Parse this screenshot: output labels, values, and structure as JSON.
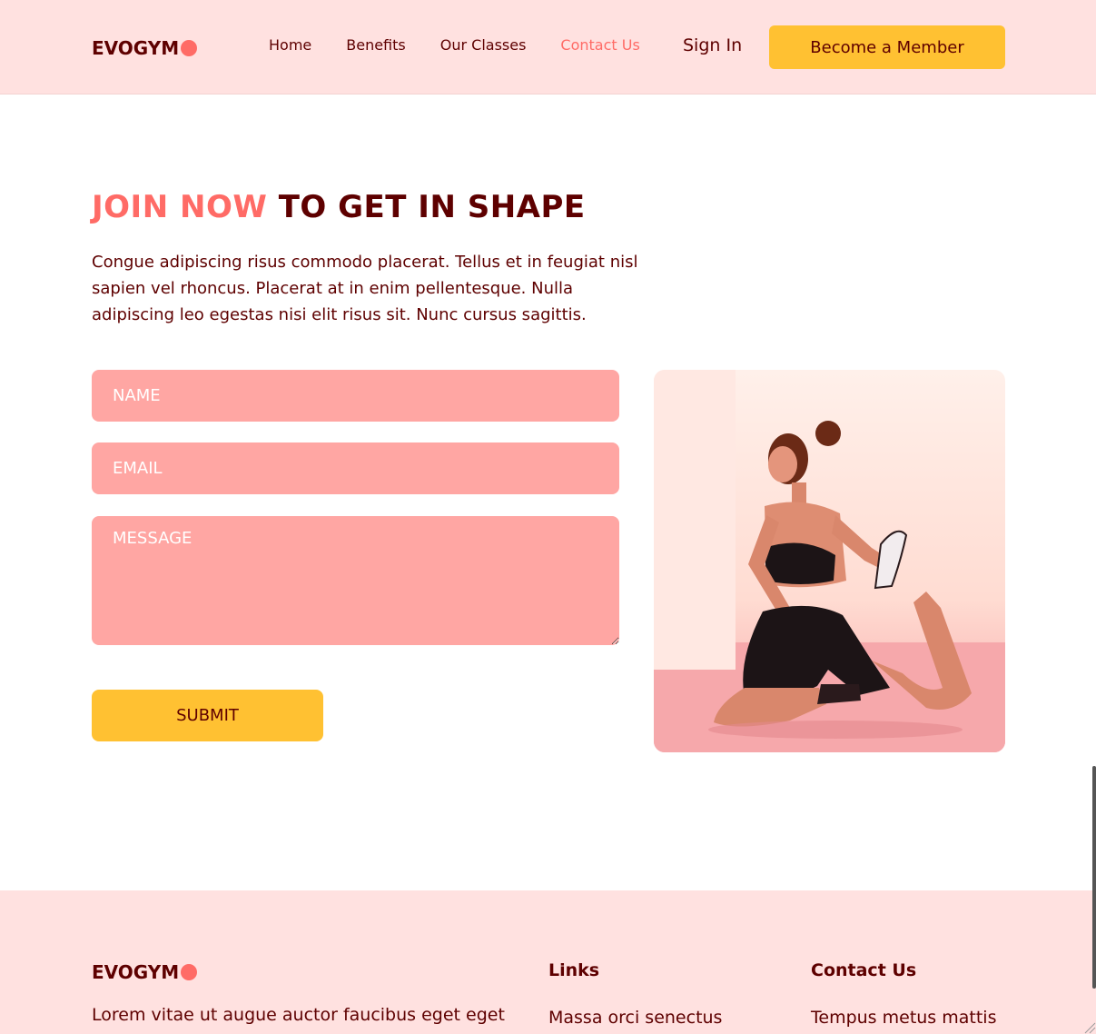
{
  "navbar": {
    "logo": "EVOGYM",
    "links": [
      "Home",
      "Benefits",
      "Our Classes",
      "Contact Us"
    ],
    "active_link": "Contact Us",
    "sign_in": "Sign In",
    "cta": "Become a Member"
  },
  "contact": {
    "headline_accent": "JOIN NOW",
    "headline_rest": "TO GET IN SHAPE",
    "intro": "Congue adipiscing risus commodo placerat. Tellus et in feugiat nisl sapien vel rhoncus. Placerat at in enim pellentesque. Nulla adipiscing leo egestas nisi elit risus sit. Nunc cursus sagittis.",
    "name_placeholder": "NAME",
    "email_placeholder": "EMAIL",
    "message_placeholder": "MESSAGE",
    "submit_label": "SUBMIT"
  },
  "footer": {
    "logo": "EVOGYM",
    "about": "Lorem vitae ut augue auctor faucibus eget eget",
    "links_heading": "Links",
    "links_first": "Massa orci senectus",
    "contact_heading": "Contact Us",
    "contact_first": "Tempus metus mattis"
  },
  "colors": {
    "brand_dark": "#5e0000",
    "accent": "#ff6b66",
    "cta_yellow": "#ffc132",
    "nav_bg": "#ffe1e0",
    "field_bg": "#ffa6a3"
  }
}
